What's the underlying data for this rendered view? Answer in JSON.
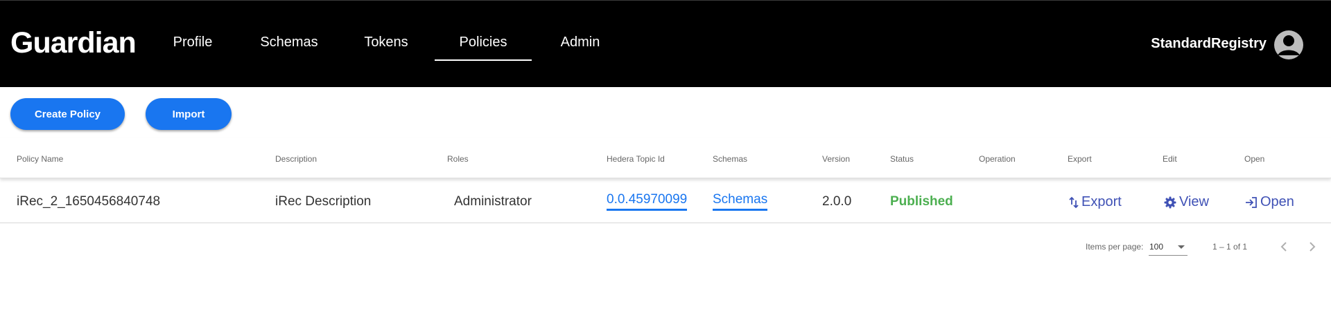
{
  "header": {
    "logo": "Guardian",
    "nav": [
      {
        "label": "Profile"
      },
      {
        "label": "Schemas"
      },
      {
        "label": "Tokens"
      },
      {
        "label": "Policies",
        "active": true
      },
      {
        "label": "Admin"
      }
    ],
    "username": "StandardRegistry"
  },
  "toolbar": {
    "create_label": "Create Policy",
    "import_label": "Import"
  },
  "table": {
    "columns": [
      "Policy Name",
      "Description",
      "Roles",
      "Hedera Topic Id",
      "Schemas",
      "Version",
      "Status",
      "Operation",
      "Export",
      "Edit",
      "Open"
    ],
    "rows": [
      {
        "name": "iRec_2_1650456840748",
        "description": "iRec Description",
        "roles": "Administrator",
        "topic_id": "0.0.45970099",
        "schemas": "Schemas",
        "version": "2.0.0",
        "status": "Published",
        "operation": "",
        "export": "Export",
        "edit": "View",
        "open": "Open"
      }
    ]
  },
  "paginator": {
    "items_label": "Items per page:",
    "page_size": "100",
    "range": "1 – 1 of 1"
  },
  "colors": {
    "primary": "#1976f0",
    "status_published": "#4caf50",
    "action": "#3f51b5",
    "topbar": "#000000"
  },
  "icons": {
    "export": "export-arrows-icon",
    "edit": "gear-icon",
    "open": "login-icon",
    "avatar": "account-circle-icon"
  }
}
